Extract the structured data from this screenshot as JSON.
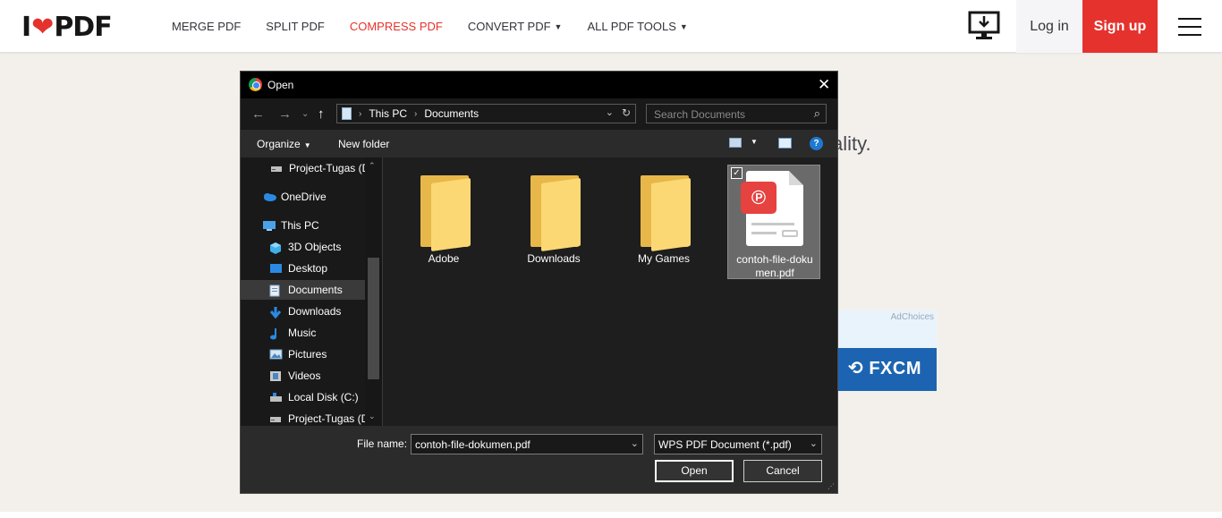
{
  "site": {
    "logo_left": "I",
    "logo_right": "PDF",
    "nav": [
      {
        "label": "MERGE PDF",
        "active": false,
        "caret": ""
      },
      {
        "label": "SPLIT PDF",
        "active": false,
        "caret": ""
      },
      {
        "label": "COMPRESS PDF",
        "active": true,
        "caret": ""
      },
      {
        "label": "CONVERT PDF",
        "active": false,
        "caret": "▼"
      },
      {
        "label": "ALL PDF TOOLS",
        "active": false,
        "caret": "▼"
      }
    ],
    "login_label": "Log in",
    "signup_label": "Sign up",
    "bg_text_fragment": "ality.",
    "ad": {
      "choices_label": "AdChoices",
      "brand": "FXCM"
    },
    "colors": {
      "accent": "#e5322d",
      "background": "#f3f0ec"
    }
  },
  "dialog": {
    "title": "Open",
    "address": {
      "segments": [
        "This PC",
        "Documents"
      ]
    },
    "search_placeholder": "Search Documents",
    "toolbar": {
      "organize_label": "Organize",
      "new_folder_label": "New folder",
      "help_label": "?"
    },
    "sidebar": [
      {
        "label": "Project-Tugas (D",
        "icon": "drive-icon",
        "selected": false
      },
      {
        "label": "OneDrive",
        "icon": "cloud-icon",
        "selected": false
      },
      {
        "label": "This PC",
        "icon": "computer-icon",
        "selected": false
      },
      {
        "label": "3D Objects",
        "icon": "cube-icon",
        "selected": false
      },
      {
        "label": "Desktop",
        "icon": "desktop-icon",
        "selected": false
      },
      {
        "label": "Documents",
        "icon": "document-icon",
        "selected": true
      },
      {
        "label": "Downloads",
        "icon": "download-arrow-icon",
        "selected": false
      },
      {
        "label": "Music",
        "icon": "music-note-icon",
        "selected": false
      },
      {
        "label": "Pictures",
        "icon": "picture-icon",
        "selected": false
      },
      {
        "label": "Videos",
        "icon": "video-icon",
        "selected": false
      },
      {
        "label": "Local Disk (C:)",
        "icon": "disk-icon",
        "selected": false
      },
      {
        "label": "Project-Tugas (D",
        "icon": "drive-icon",
        "selected": false
      }
    ],
    "files": [
      {
        "name": "Adobe",
        "type": "folder",
        "selected": false
      },
      {
        "name": "Downloads",
        "type": "folder",
        "selected": false
      },
      {
        "name": "My Games",
        "type": "folder",
        "selected": false
      },
      {
        "name": "contoh-file-dokumen.pdf",
        "type": "pdf",
        "selected": true,
        "label_line1": "contoh-file-doku",
        "label_line2": "men.pdf"
      }
    ],
    "file_name_label": "File name:",
    "file_name_value": "contoh-file-dokumen.pdf",
    "file_type_value": "WPS PDF Document (*.pdf)",
    "open_label": "Open",
    "cancel_label": "Cancel"
  }
}
